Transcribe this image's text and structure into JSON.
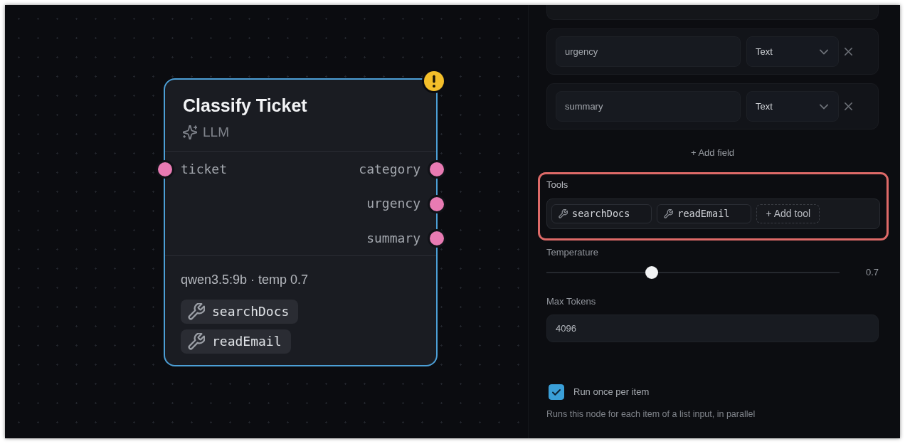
{
  "canvas": {
    "node": {
      "title": "Classify Ticket",
      "type_label": "LLM",
      "warning": true,
      "inputs": [
        {
          "label": "ticket"
        }
      ],
      "outputs": [
        {
          "label": "category"
        },
        {
          "label": "urgency"
        },
        {
          "label": "summary"
        }
      ],
      "model_info": "qwen3.5:9b · temp 0.7",
      "tools": [
        "searchDocs",
        "readEmail"
      ]
    }
  },
  "settings": {
    "output_fields": [
      {
        "name": "urgency",
        "type": "Text"
      },
      {
        "name": "summary",
        "type": "Text"
      }
    ],
    "add_field_button": "+ Add field",
    "tools_section": {
      "label": "Tools",
      "highlighted": true,
      "tools": [
        "searchDocs",
        "readEmail"
      ],
      "add_button": "+ Add tool"
    },
    "temperature": {
      "label": "Temperature",
      "level": 0.36,
      "reading": "0.7"
    },
    "max_tokens": {
      "label": "Max Tokens",
      "value": "4096"
    },
    "run_once": {
      "label": "Run once per item",
      "checked": true,
      "description": "Runs this node for each item of a list input, in parallel"
    }
  }
}
